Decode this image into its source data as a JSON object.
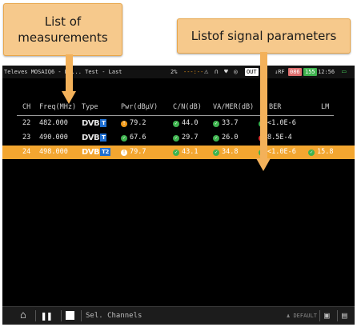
{
  "callouts": {
    "left": "List of measurements",
    "right": "Listof signal parameters"
  },
  "statusbar": {
    "left": "Televes MOSAIQ6 - Dr... Test - Last",
    "percent": "2%",
    "out": "OUT",
    "rf": "RF",
    "badge1": "086",
    "badge2": "155",
    "time": "12:56"
  },
  "table": {
    "headers": {
      "ch": "CH",
      "freq": "Freq(MHz)",
      "type": "Type",
      "pwr": "Pwr(dBµV)",
      "cn": "C/N(dB)",
      "va": "VA/MER(dB)",
      "ber": "BER",
      "lm": "LM"
    },
    "rows": [
      {
        "ch": "22",
        "freq": "482.000",
        "type": "DVB",
        "gen": "T",
        "pwr": "79.2",
        "cn": "44.0",
        "va": "33.7",
        "ber": "<1.0E-6",
        "lm": ""
      },
      {
        "ch": "23",
        "freq": "490.000",
        "type": "DVB",
        "gen": "T",
        "pwr": "67.6",
        "cn": "29.7",
        "va": "26.0",
        "ber": "8.5E-4",
        "lm": ""
      },
      {
        "ch": "24",
        "freq": "498.000",
        "type": "DVB",
        "gen": "T2",
        "pwr": "79.7",
        "cn": "43.1",
        "va": "34.8",
        "ber": "<1.0E-6",
        "lm": "15.8"
      }
    ]
  },
  "toolbar": {
    "sel_channels": "Sel. Channels",
    "default": "DEFAULT"
  },
  "colors": {
    "callout": "#f6c98c",
    "selected_row": "#f3a630",
    "ok": "#3fb34f",
    "warn": "#f09a1a",
    "bad": "#e0322b",
    "dvb_gen": "#1f6fd1"
  }
}
